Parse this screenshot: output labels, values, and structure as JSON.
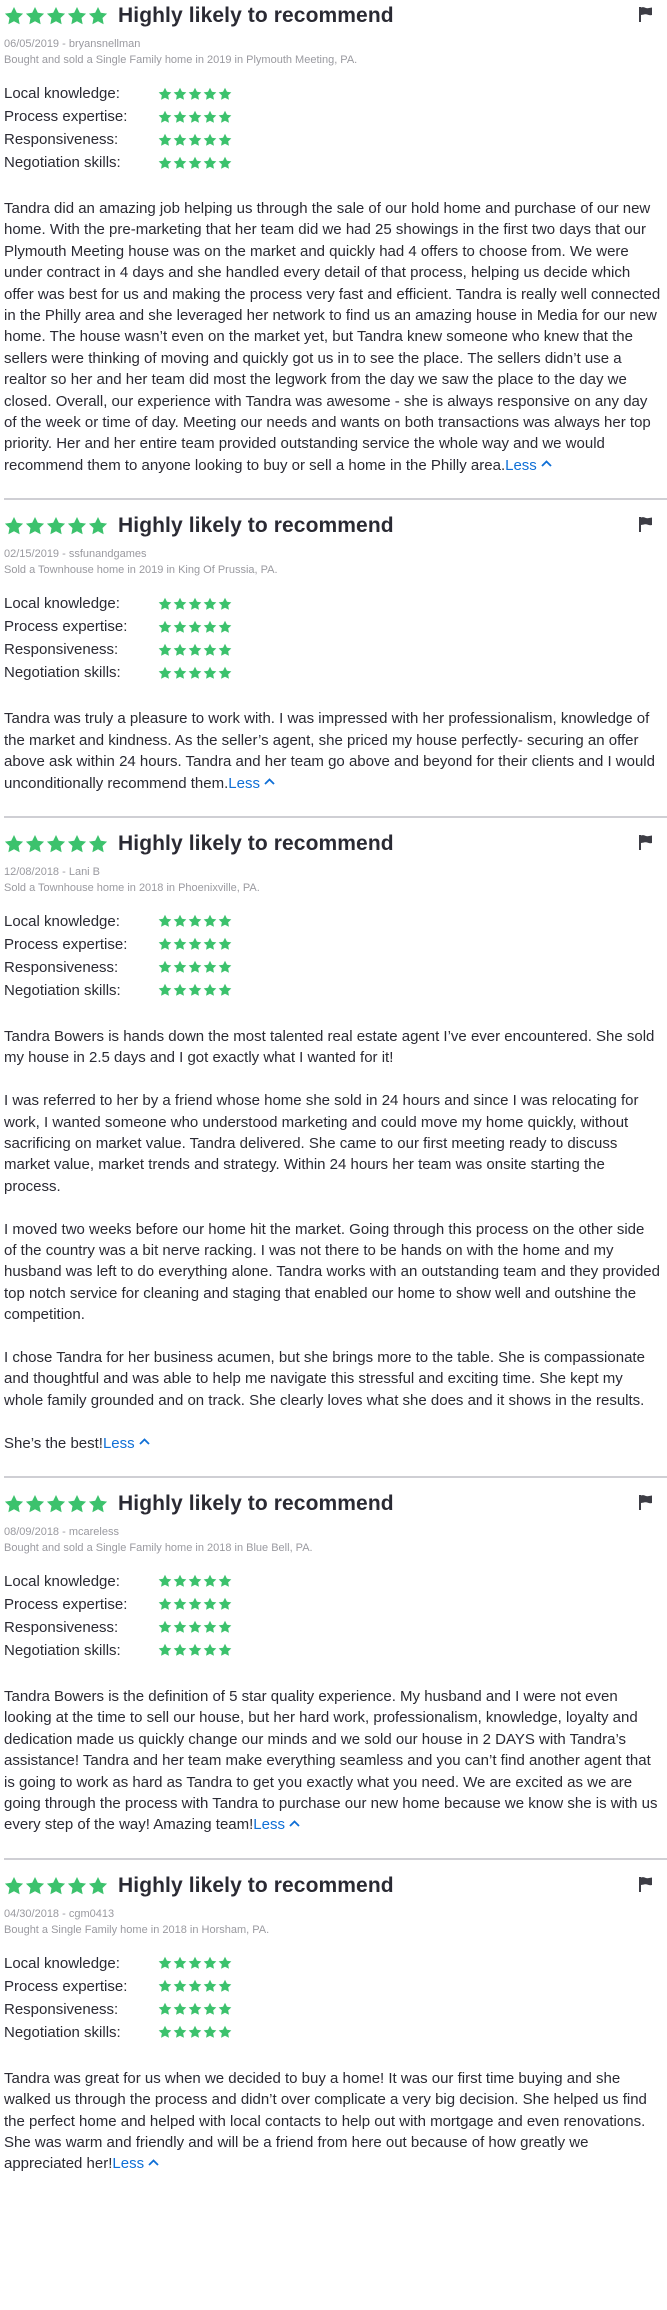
{
  "colors": {
    "star": "#3cc26d",
    "link": "#0f6fd6",
    "text": "#2a2a33",
    "meta": "#9a9aa0",
    "divider": "#cfcfd4"
  },
  "icons": {
    "star": "star-icon",
    "flag": "flag-icon",
    "chevron": "chevron-up-icon"
  },
  "rating_labels": [
    "Local knowledge:",
    "Process expertise:",
    "Responsiveness:",
    "Negotiation skills:"
  ],
  "reviews": [
    {
      "headline": "Highly likely to recommend",
      "date_user": "06/05/2019 - bryansnellman",
      "transaction": "Bought and sold a Single Family home in 2019 in Plymouth Meeting, PA.",
      "overall_stars": 5,
      "ratings": [
        5,
        5,
        5,
        5
      ],
      "paragraphs": [
        "Tandra did an amazing job helping us through the sale of our hold home and purchase of our new home. With the pre-marketing that her team did we had 25 showings in the first two days that our Plymouth Meeting house was on the market and quickly had 4 offers to choose from. We were under contract in 4 days and she handled every detail of that process, helping us decide which offer was best for us and making the process very fast and efficient. Tandra is really well connected in the Philly area and she leveraged her network to find us an amazing house in Media for our new home. The house wasn’t even on the market yet, but Tandra knew someone who knew that the sellers were thinking of moving and quickly got us in to see the place.  The sellers didn’t use a realtor so her and her team did most the legwork from the day we saw the place to the day we closed. Overall, our experience with Tandra was awesome - she is always responsive on any day of the week or time of day. Meeting our needs and wants on both transactions was always her top priority. Her and her entire team provided outstanding service the whole way and we would recommend them to anyone looking to buy or sell a home in the Philly area."
      ],
      "less_label": "Less"
    },
    {
      "headline": "Highly likely to recommend",
      "date_user": "02/15/2019 - ssfunandgames",
      "transaction": "Sold a Townhouse home in 2019 in King Of Prussia, PA.",
      "overall_stars": 5,
      "ratings": [
        5,
        5,
        5,
        5
      ],
      "paragraphs": [
        "Tandra was truly a pleasure to work with. I was impressed with her professionalism, knowledge of the market and kindness. As the seller’s agent, she priced my house perfectly- securing an offer above ask within 24 hours. Tandra and her team go above and beyond for their clients and I would unconditionally recommend them."
      ],
      "less_label": "Less"
    },
    {
      "headline": "Highly likely to recommend",
      "date_user": "12/08/2018 - Lani B",
      "transaction": "Sold a Townhouse home in 2018 in Phoenixville, PA.",
      "overall_stars": 5,
      "ratings": [
        5,
        5,
        5,
        5
      ],
      "paragraphs": [
        "Tandra Bowers is hands down the most talented real estate agent I’ve ever encountered. She sold my house in 2.5 days and I got exactly what I wanted for it!",
        "I was referred to her by a friend whose home she sold in 24 hours and since I was relocating for work, I wanted someone who understood marketing and could move my home quickly, without sacrificing on market value. Tandra delivered. She came to our first meeting ready to discuss market value, market trends and strategy. Within 24 hours her team was onsite starting the process.",
        "I moved two weeks before our home hit the market. Going through this process on the other side of the country was a bit nerve racking. I was not there to be hands on with the home and my husband was left to do everything alone. Tandra works with an outstanding team and they provided top notch service for cleaning and staging that enabled our home to show well and outshine the competition.",
        "I chose Tandra for her business acumen, but she brings more to the table. She is compassionate and thoughtful and was able to help me navigate this stressful and exciting time. She kept my whole family grounded and on track. She clearly loves what she does and it shows in the results.",
        "She’s the best!"
      ],
      "less_label": "Less"
    },
    {
      "headline": "Highly likely to recommend",
      "date_user": "08/09/2018 - mcareless",
      "transaction": "Bought and sold a Single Family home in 2018 in Blue Bell, PA.",
      "overall_stars": 5,
      "ratings": [
        5,
        5,
        5,
        5
      ],
      "paragraphs": [
        "Tandra Bowers is the definition of 5 star quality experience. My husband and I were not even looking at the time to sell our house, but her hard work, professionalism, knowledge, loyalty and dedication made us quickly change our minds and we sold our house in 2 DAYS with Tandra’s assistance! Tandra and her team make everything seamless and you can’t find another agent that is going to work as hard as Tandra to get you exactly what you need. We are excited as we are going through the process with Tandra to purchase our new home because we know she is with us every step of the way! Amazing team!"
      ],
      "less_label": "Less"
    },
    {
      "headline": "Highly likely to recommend",
      "date_user": "04/30/2018 - cgm0413",
      "transaction": "Bought a Single Family home in 2018 in Horsham, PA.",
      "overall_stars": 5,
      "ratings": [
        5,
        5,
        5,
        5
      ],
      "paragraphs": [
        "Tandra was great for us when we decided to buy a home! It was our first time buying and she walked us through the process and didn’t over complicate a very big decision. She helped us find the perfect home and helped with local contacts to help out with mortgage and even renovations. She was warm and friendly and will be a friend from here out because of how greatly we appreciated her!"
      ],
      "less_label": "Less"
    }
  ]
}
